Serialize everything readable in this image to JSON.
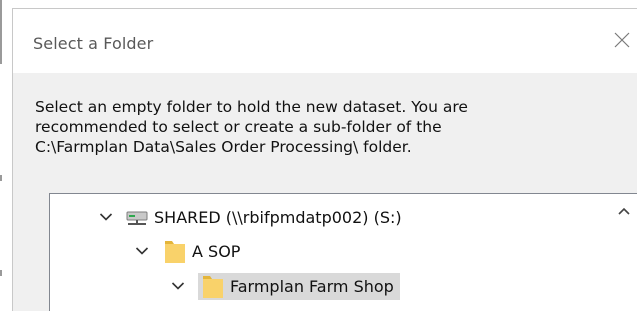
{
  "dialog": {
    "title": "Select a Folder",
    "instructions": [
      "Select an empty folder to hold the new dataset. You are",
      "recommended to select or create a sub-folder of the",
      "C:\\Farmplan Data\\Sales Order Processing\\ folder."
    ]
  },
  "tree": {
    "items": [
      {
        "label": "SHARED (\\\\rbifpmdatp002) (S:)",
        "icon": "network-drive-icon",
        "expanded": true,
        "selected": false
      },
      {
        "label": "A SOP",
        "icon": "folder-icon",
        "expanded": true,
        "selected": false
      },
      {
        "label": "Farmplan Farm Shop",
        "icon": "folder-icon",
        "expanded": true,
        "selected": true
      }
    ]
  },
  "colors": {
    "folder": "#f9d26a",
    "folder_dark": "#e4b53a",
    "selection": "#d9d9d9",
    "drive_green": "#2fa84f"
  }
}
